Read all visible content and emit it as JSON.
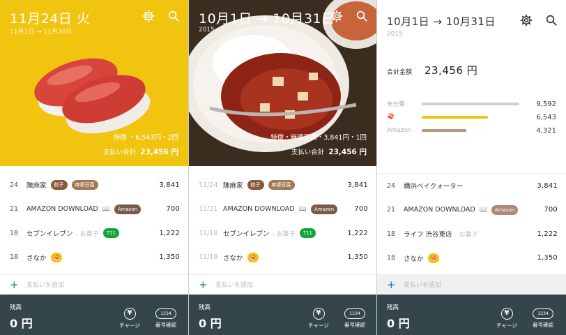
{
  "screens": [
    {
      "header": {
        "title": "11月24日 火",
        "subtitle": "11月1日 → 11月30日"
      },
      "info": {
        "item": "特徴 ・6,543円・2回",
        "total_label": "支払い合計",
        "total": "23,456 円"
      },
      "rows": [
        {
          "day": "24",
          "shop": "陳麻家",
          "category": "",
          "tags": [
            "餃子",
            "麻婆豆腐"
          ],
          "amount": "3,841"
        },
        {
          "day": "21",
          "shop": "AMAZON DOWNLOAD",
          "category": "",
          "tags": [
            "Amazon"
          ],
          "amount": "700"
        },
        {
          "day": "18",
          "shop": "セブンイレブン",
          "category": "- お菓子",
          "tags": [
            "711"
          ],
          "amount": "1,222"
        },
        {
          "day": "18",
          "shop": "さなか",
          "category": "",
          "tags": [
            "🍣"
          ],
          "amount": "1,350"
        }
      ],
      "add_label": "支払いを追加",
      "footer": {
        "balance_label": "残高",
        "balance": "0 円",
        "charge_label": "チャージ",
        "number_label": "番号確認",
        "number_icon_text": "1234",
        "yen_icon_text": "¥"
      }
    },
    {
      "header": {
        "title": "10月1日 → 10月31日",
        "subtitle": "2015"
      },
      "info": {
        "item": "特徴・麻婆豆腐・3,841円・1回",
        "total_label": "支払い合計",
        "total": "23,456 円"
      },
      "rows": [
        {
          "day": "11/24",
          "shop": "陳麻家",
          "category": "",
          "tags": [
            "餃子",
            "麻婆豆腐"
          ],
          "amount": "3,841"
        },
        {
          "day": "11/21",
          "shop": "AMAZON DOWNLOAD",
          "category": "",
          "tags": [
            "Amazon"
          ],
          "amount": "700"
        },
        {
          "day": "11/18",
          "shop": "セブンイレブン",
          "category": "- お菓子",
          "tags": [
            "711"
          ],
          "amount": "1,222"
        },
        {
          "day": "11/18",
          "shop": "さなか",
          "category": "",
          "tags": [
            "🍣"
          ],
          "amount": "1,350"
        }
      ],
      "add_label": "支払いを追加",
      "footer": {
        "balance_label": "残高",
        "balance": "0 円",
        "charge_label": "チャージ",
        "number_label": "番号確認",
        "number_icon_text": "1234",
        "yen_icon_text": "¥"
      }
    },
    {
      "header": {
        "title": "10月1日 → 10月31日",
        "subtitle": "2015"
      },
      "summary": {
        "total_label": "合計金額",
        "total": "23,456 円",
        "stats": [
          {
            "name": "未分類",
            "value": "9,592",
            "fraction": 0.5,
            "color": "#cfcfcf"
          },
          {
            "name": "🍣",
            "value": "6,543",
            "fraction": 0.34,
            "color": "#f1c40f"
          },
          {
            "name": "Amazon",
            "value": "4,321",
            "fraction": 0.23,
            "color": "#b9977e"
          }
        ]
      },
      "rows": [
        {
          "day": "24",
          "shop": "横浜ベイクォーター",
          "category": "",
          "tags": [],
          "amount": "3,841"
        },
        {
          "day": "21",
          "shop": "AMAZON DOWNLOAD",
          "category": "",
          "tags": [
            "Amazon"
          ],
          "amount": "700"
        },
        {
          "day": "18",
          "shop": "ライフ 渋谷東店",
          "category": "- お菓子",
          "tags": [],
          "amount": "1,222"
        },
        {
          "day": "18",
          "shop": "さなか",
          "category": "",
          "tags": [
            "🍣"
          ],
          "amount": "1,350"
        }
      ],
      "add_label": "支払いを追加",
      "footer": {
        "balance_label": "残高",
        "balance": "0 円",
        "charge_label": "チャージ",
        "number_label": "番号確認",
        "number_icon_text": "1234",
        "yen_icon_text": "¥"
      }
    }
  ],
  "colors": {
    "accent": "#f1c40f",
    "footer": "#34454b",
    "plus": "#1b6fa8",
    "seven_eleven": "#13a538"
  },
  "icons": {
    "settings": "gear-icon",
    "search": "search-icon",
    "add": "plus-icon",
    "charge": "yen-circle-icon",
    "number": "number-pill-icon",
    "book": "book-icon"
  }
}
